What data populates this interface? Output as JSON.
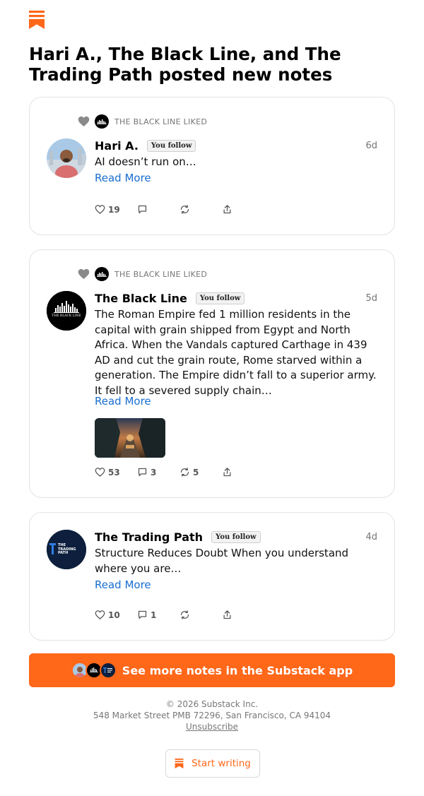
{
  "header": {
    "headline": "Hari A., The Black Line, and The Trading Path posted new notes"
  },
  "notes": [
    {
      "liked_by": "THE BLACK LINE LIKED",
      "author": "Hari A.",
      "follow_badge": "You follow",
      "age": "6d",
      "body": "AI doesn’t run on…",
      "read_more": "Read More",
      "likes": "19",
      "comments": "",
      "restacks": ""
    },
    {
      "liked_by": "THE BLACK LINE LIKED",
      "author": "The Black Line",
      "follow_badge": "You follow",
      "age": "5d",
      "body": "The Roman Empire fed 1 million residents in the capital with grain shipped from Egypt and North Africa. When the Vandals captured Carthage in 439 AD and cut the grain route, Rome starved within a generation. The Empire didn’t fall to a superior army. It fell to a severed supply chain…",
      "read_more": "Read More",
      "likes": "53",
      "comments": "3",
      "restacks": "5",
      "avatar_text": "THE BLACK LINE"
    },
    {
      "author": "The Trading Path",
      "follow_badge": "You follow",
      "age": "4d",
      "body": "Structure Reduces Doubt When you understand where you are…",
      "read_more": "Read More",
      "likes": "10",
      "comments": "1",
      "restacks": "",
      "avatar_text_1": "THE",
      "avatar_text_2": "TRADING",
      "avatar_text_3": "PATH"
    }
  ],
  "cta": {
    "label": "See more notes in the Substack app"
  },
  "footer": {
    "copyright": "© 2026 Substack Inc.",
    "address": "548 Market Street PMB 72296, San Francisco, CA 94104",
    "unsubscribe": "Unsubscribe"
  },
  "start_writing": {
    "label": "Start writing"
  },
  "colors": {
    "brand": "#ff6719",
    "link": "#1a6fd1",
    "muted": "#757575"
  },
  "icons": [
    "substack-logo-icon",
    "heart-icon",
    "comment-icon",
    "restack-icon",
    "share-icon"
  ]
}
